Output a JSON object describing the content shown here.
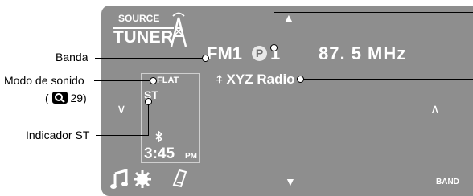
{
  "source": {
    "label_small": "SOURCE",
    "label_big": "TUNER"
  },
  "tuner": {
    "band": "FM1",
    "preset_letter": "P",
    "preset_number": "1",
    "frequency": "87. 5  MHz",
    "station": "XYZ Radio"
  },
  "status": {
    "sound_mode": "FLAT",
    "stereo": "ST",
    "time": "3:45",
    "ampm": "PM"
  },
  "buttons": {
    "band": "BAND"
  },
  "callouts": {
    "band": "Banda",
    "sound_mode": "Modo de sonido",
    "sound_mode_ref_open": "(",
    "sound_mode_ref_page": "29)",
    "st_indicator": "Indicador ST"
  }
}
